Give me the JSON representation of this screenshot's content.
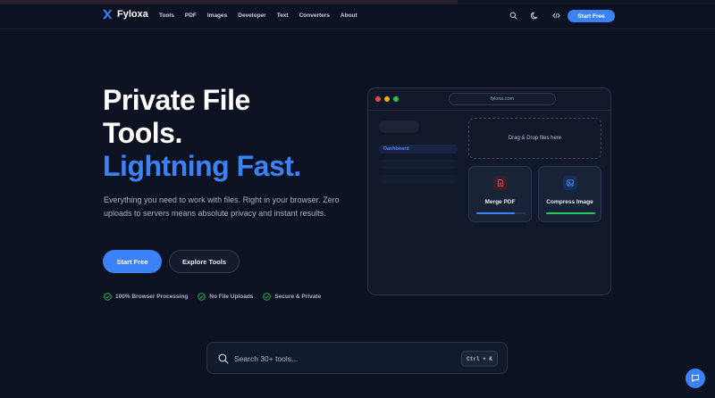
{
  "colors": {
    "background": "#0c1222",
    "accent": "#3b82f6",
    "success": "#22c55e",
    "danger": "#ef4444"
  },
  "navbar": {
    "brand": "Fyloxa",
    "links": [
      "Tools",
      "PDF",
      "Images",
      "Developer",
      "Text",
      "Converters",
      "About"
    ],
    "icons": [
      "search-icon",
      "moon-icon",
      "code-icon"
    ],
    "cta_label": "Start Free"
  },
  "hero": {
    "title_line1": "Private File",
    "title_line2": "Tools.",
    "title_line3": "Lightning Fast.",
    "description": "Everything you need to work with files. Right in your browser. Zero uploads to servers means absolute privacy and instant results.",
    "primary_button": "Start Free",
    "secondary_button": "Explore Tools",
    "features": [
      "100% Browser Processing",
      "No File Uploads",
      "Secure & Private"
    ]
  },
  "mock_window": {
    "url": "fyloxa.com",
    "sidebar_active": "Dashboard",
    "dropzone_text": "Drag & Drop files here",
    "cards": [
      {
        "label": "Merge PDF",
        "icon": "pdf-file-icon",
        "progress": 0.78
      },
      {
        "label": "Compress Image",
        "icon": "image-icon",
        "progress": 1.0
      }
    ]
  },
  "search": {
    "placeholder": "Search 30+ tools...",
    "shortcut": "Ctrl + K"
  },
  "chat": {
    "icon": "chat-icon"
  }
}
